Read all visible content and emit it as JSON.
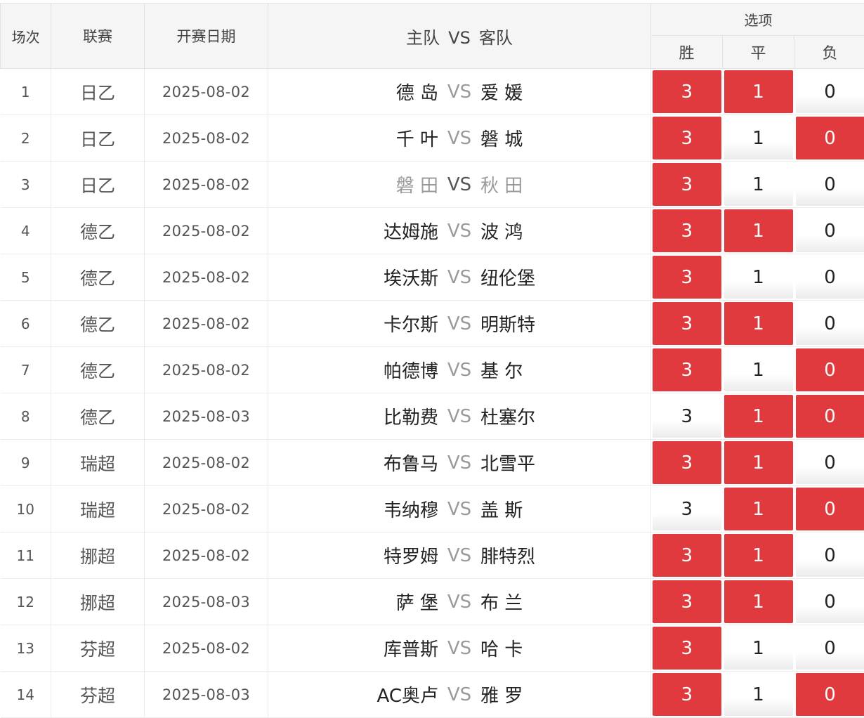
{
  "header": {
    "no": "场次",
    "league": "联赛",
    "date": "开赛日期",
    "home": "主队",
    "vs": "VS",
    "away": "客队",
    "options_group": "选项",
    "win": "胜",
    "draw": "平",
    "lose": "负"
  },
  "colors": {
    "selected": "#e03a3e",
    "header_bg": "#f5f5f5"
  },
  "rows": [
    {
      "no": "1",
      "league": "日乙",
      "date": "2025-08-02",
      "home": "德 岛",
      "vs": "VS",
      "away": "爱 媛",
      "dim": false,
      "win": "3",
      "draw": "1",
      "lose": "0",
      "sel": [
        true,
        true,
        false
      ]
    },
    {
      "no": "2",
      "league": "日乙",
      "date": "2025-08-02",
      "home": "千 叶",
      "vs": "VS",
      "away": "磐 城",
      "dim": false,
      "win": "3",
      "draw": "1",
      "lose": "0",
      "sel": [
        true,
        false,
        true
      ]
    },
    {
      "no": "3",
      "league": "日乙",
      "date": "2025-08-02",
      "home": "磐 田",
      "vs": "VS",
      "away": "秋 田",
      "dim": true,
      "win": "3",
      "draw": "1",
      "lose": "0",
      "sel": [
        true,
        false,
        false
      ]
    },
    {
      "no": "4",
      "league": "德乙",
      "date": "2025-08-02",
      "home": "达姆施",
      "vs": "VS",
      "away": "波 鸿",
      "dim": false,
      "win": "3",
      "draw": "1",
      "lose": "0",
      "sel": [
        true,
        true,
        false
      ]
    },
    {
      "no": "5",
      "league": "德乙",
      "date": "2025-08-02",
      "home": "埃沃斯",
      "vs": "VS",
      "away": "纽伦堡",
      "dim": false,
      "win": "3",
      "draw": "1",
      "lose": "0",
      "sel": [
        true,
        false,
        false
      ]
    },
    {
      "no": "6",
      "league": "德乙",
      "date": "2025-08-02",
      "home": "卡尔斯",
      "vs": "VS",
      "away": "明斯特",
      "dim": false,
      "win": "3",
      "draw": "1",
      "lose": "0",
      "sel": [
        true,
        true,
        false
      ]
    },
    {
      "no": "7",
      "league": "德乙",
      "date": "2025-08-02",
      "home": "帕德博",
      "vs": "VS",
      "away": "基 尔",
      "dim": false,
      "win": "3",
      "draw": "1",
      "lose": "0",
      "sel": [
        true,
        false,
        true
      ]
    },
    {
      "no": "8",
      "league": "德乙",
      "date": "2025-08-03",
      "home": "比勒费",
      "vs": "VS",
      "away": "杜塞尔",
      "dim": false,
      "win": "3",
      "draw": "1",
      "lose": "0",
      "sel": [
        false,
        true,
        true
      ]
    },
    {
      "no": "9",
      "league": "瑞超",
      "date": "2025-08-02",
      "home": "布鲁马",
      "vs": "VS",
      "away": "北雪平",
      "dim": false,
      "win": "3",
      "draw": "1",
      "lose": "0",
      "sel": [
        true,
        true,
        false
      ]
    },
    {
      "no": "10",
      "league": "瑞超",
      "date": "2025-08-02",
      "home": "韦纳穆",
      "vs": "VS",
      "away": "盖 斯",
      "dim": false,
      "win": "3",
      "draw": "1",
      "lose": "0",
      "sel": [
        false,
        true,
        true
      ]
    },
    {
      "no": "11",
      "league": "挪超",
      "date": "2025-08-02",
      "home": "特罗姆",
      "vs": "VS",
      "away": "腓特烈",
      "dim": false,
      "win": "3",
      "draw": "1",
      "lose": "0",
      "sel": [
        true,
        true,
        false
      ]
    },
    {
      "no": "12",
      "league": "挪超",
      "date": "2025-08-03",
      "home": "萨 堡",
      "vs": "VS",
      "away": "布 兰",
      "dim": false,
      "win": "3",
      "draw": "1",
      "lose": "0",
      "sel": [
        true,
        true,
        false
      ]
    },
    {
      "no": "13",
      "league": "芬超",
      "date": "2025-08-02",
      "home": "库普斯",
      "vs": "VS",
      "away": "哈 卡",
      "dim": false,
      "win": "3",
      "draw": "1",
      "lose": "0",
      "sel": [
        true,
        false,
        false
      ]
    },
    {
      "no": "14",
      "league": "芬超",
      "date": "2025-08-03",
      "home": "AC奥卢",
      "vs": "VS",
      "away": "雅 罗",
      "dim": false,
      "win": "3",
      "draw": "1",
      "lose": "0",
      "sel": [
        true,
        false,
        true
      ]
    }
  ]
}
